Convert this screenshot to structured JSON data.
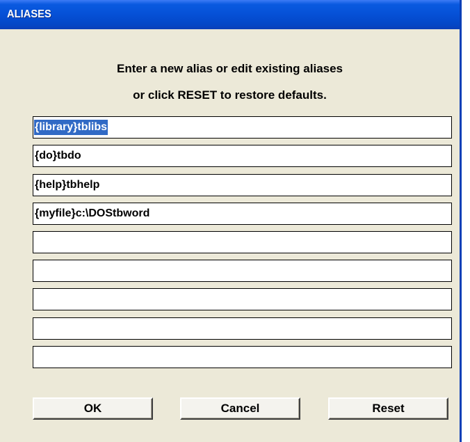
{
  "window": {
    "title": "ALIASES"
  },
  "instructions": {
    "line1": "Enter a new alias or edit existing aliases",
    "line2": "or click RESET to restore defaults."
  },
  "aliases": [
    "{library}tblibs",
    "{do}tbdo",
    "{help}tbhelp",
    "{myfile}c:\\DOStbword",
    "",
    "",
    "",
    "",
    ""
  ],
  "buttons": {
    "ok": "OK",
    "cancel": "Cancel",
    "reset": "Reset"
  },
  "colors": {
    "titlebar": "#0550d6",
    "dialog_bg": "#ece9d8",
    "selection": "#316ac5"
  }
}
